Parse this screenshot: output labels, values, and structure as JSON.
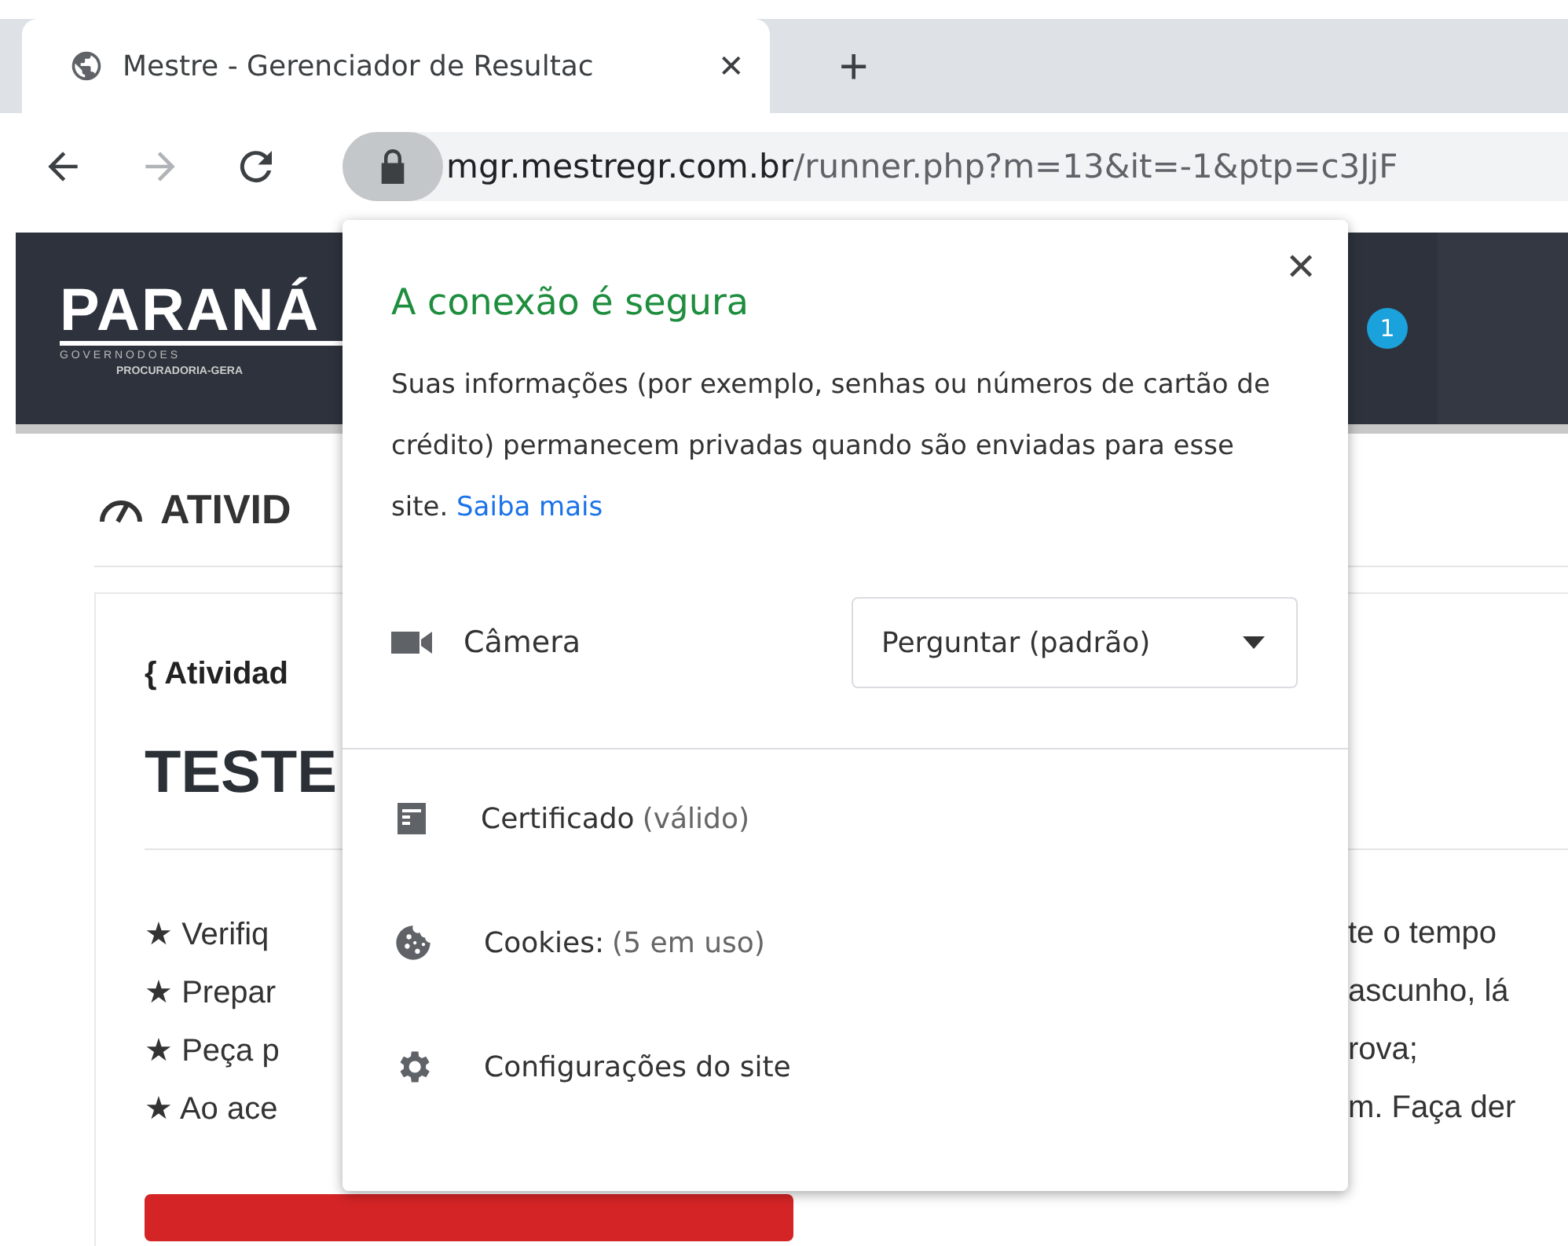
{
  "tab": {
    "title": "Mestre - Gerenciador de Resultac",
    "close": "✕"
  },
  "new_tab": "+",
  "address": {
    "host": "mgr.mestregr.com.br",
    "path": "/runner.php?m=13&it=-1&ptp=c3JjF"
  },
  "header": {
    "logo": "PARANÁ",
    "logo_line": "G O V E R N O   D O   E S",
    "logo_sub": "PROCURADORIA-GERA",
    "badge": "1"
  },
  "page": {
    "heading": "ATIVID",
    "card_label": "{ Atividad",
    "card_title": "TESTE",
    "items": [
      {
        "bullet": "★",
        "left": "Verifiq",
        "right": "te o tempo"
      },
      {
        "bullet": "★",
        "left": "Prepar",
        "right": "ascunho, lá"
      },
      {
        "bullet": "★",
        "left": "Peça p",
        "right": "rova;"
      },
      {
        "bullet": "★",
        "left": "Ao ace",
        "right": "m. Faça der"
      }
    ]
  },
  "popup": {
    "title": "A conexão é segura",
    "close": "✕",
    "text": "Suas informações (por exemplo, senhas ou números de cartão de crédito) permanecem privadas quando são enviadas para esse site.",
    "link": "Saiba mais",
    "permission": {
      "label": "Câmera",
      "value": "Perguntar (padrão)"
    },
    "rows": [
      {
        "kind": "certificate",
        "label": "Certificado",
        "detail": "(válido)"
      },
      {
        "kind": "cookies",
        "label": "Cookies:",
        "detail": "(5 em uso)"
      },
      {
        "kind": "settings",
        "label": "Configurações do site"
      }
    ]
  }
}
